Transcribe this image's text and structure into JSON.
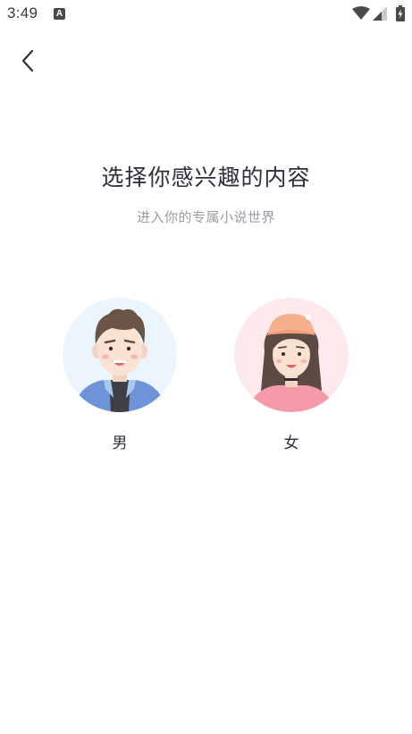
{
  "status_bar": {
    "time": "3:49",
    "notification_icon": "A"
  },
  "header": {
    "back_icon": "chevron-left-icon"
  },
  "main": {
    "title": "选择你感兴趣的内容",
    "subtitle": "进入你的专属小说世界",
    "options": [
      {
        "label": "男",
        "avatar": "male-avatar",
        "bg_color": "#eaf5fd"
      },
      {
        "label": "女",
        "avatar": "female-avatar",
        "bg_color": "#fde9ec"
      }
    ]
  },
  "colors": {
    "title_text": "#2e2f3b",
    "subtitle_text": "#9a9ca4",
    "background": "#ffffff"
  }
}
